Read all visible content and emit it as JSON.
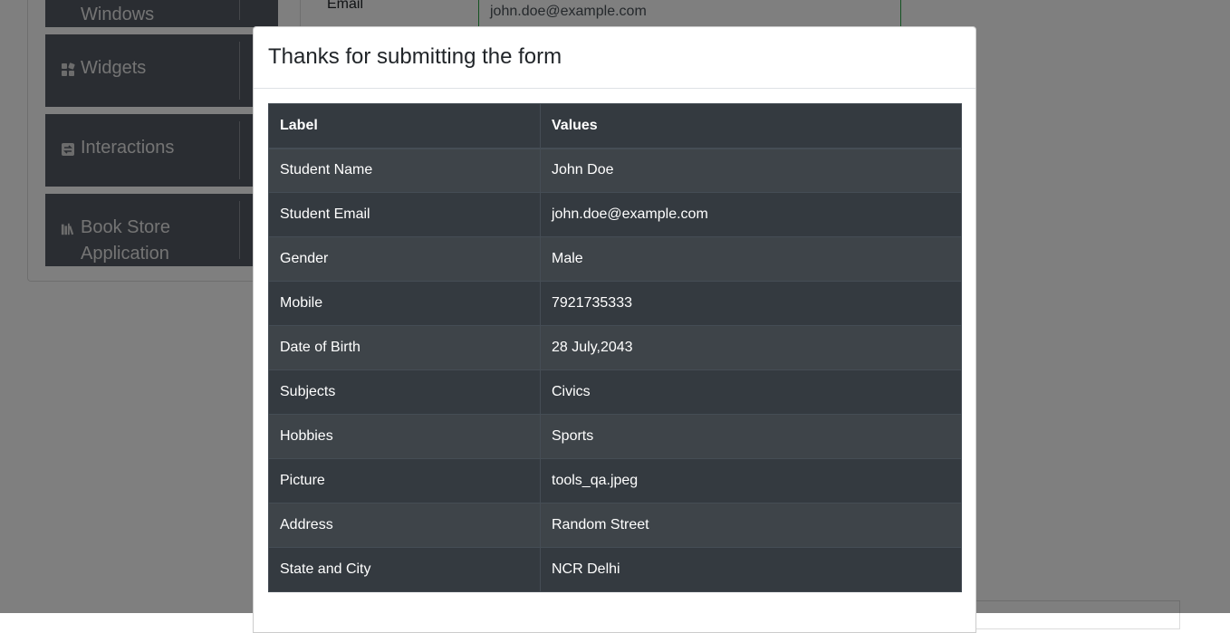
{
  "sidebar": {
    "groups": [
      {
        "label": "Windows",
        "icon": "window-icon"
      },
      {
        "label": "Widgets",
        "icon": "widgets-icon"
      },
      {
        "label": "Interactions",
        "icon": "interactions-icon"
      },
      {
        "label": "Book Store Application",
        "icon": "book-store-icon"
      }
    ]
  },
  "form": {
    "email_label": "Email",
    "email_value": "john.doe@example.com"
  },
  "modal": {
    "title": "Thanks for submitting the form",
    "table": {
      "headers": [
        "Label",
        "Values"
      ],
      "rows": [
        [
          "Student Name",
          "John Doe"
        ],
        [
          "Student Email",
          "john.doe@example.com"
        ],
        [
          "Gender",
          "Male"
        ],
        [
          "Mobile",
          "7921735333"
        ],
        [
          "Date of Birth",
          "28 July,2043"
        ],
        [
          "Subjects",
          "Civics"
        ],
        [
          "Hobbies",
          "Sports"
        ],
        [
          "Picture",
          "tools_qa.jpeg"
        ],
        [
          "Address",
          "Random Street"
        ],
        [
          "State and City",
          "NCR Delhi"
        ]
      ]
    }
  },
  "colors": {
    "sidebar_bg": "#555b64",
    "table_bg": "#343a40",
    "input_border_valid": "#28a745",
    "overlay": "rgba(0,0,0,0.5)"
  }
}
